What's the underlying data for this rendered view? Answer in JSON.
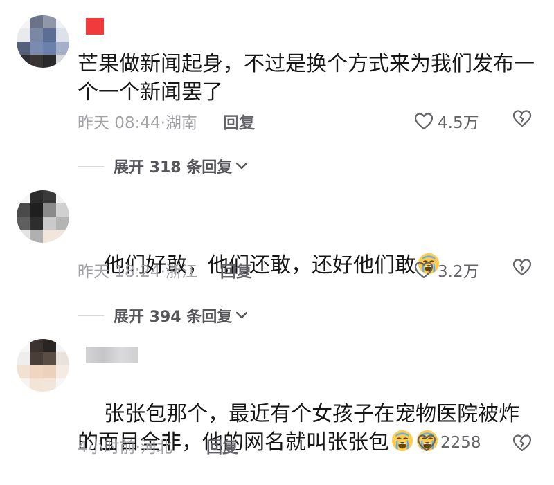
{
  "comments": [
    {
      "text": "芒果做新闻起身，不过是换个方式来为我们发布一个一个新闻罢了",
      "time": "昨天 08:44·湖南",
      "reply": "回复",
      "likes": "4.5万",
      "expand": "展开 318 条回复",
      "emoji_count": 0
    },
    {
      "text": "他们好敢，他们还敢，还好他们敢",
      "time": "昨天 18:24·浙江",
      "reply": "回复",
      "likes": "3.2万",
      "expand": "展开 394 条回复",
      "emoji_count": 1
    },
    {
      "text": "张张包那个，最近有个女孩子在宠物医院被炸的面目全非，他的网名就叫张张包",
      "time": "4小时前·河北",
      "reply": "回复",
      "likes": "2258",
      "emoji_count": 2
    }
  ],
  "colors": {
    "text": "#161616",
    "meta": "#a3a3a7",
    "action": "#646468",
    "badge_red": "#f03a3c"
  },
  "icons": {
    "like": "heart-outline-icon",
    "dislike": "broken-heart-icon",
    "expand": "chevron-down-icon",
    "emoji": "loudly-crying-face-emoji"
  }
}
